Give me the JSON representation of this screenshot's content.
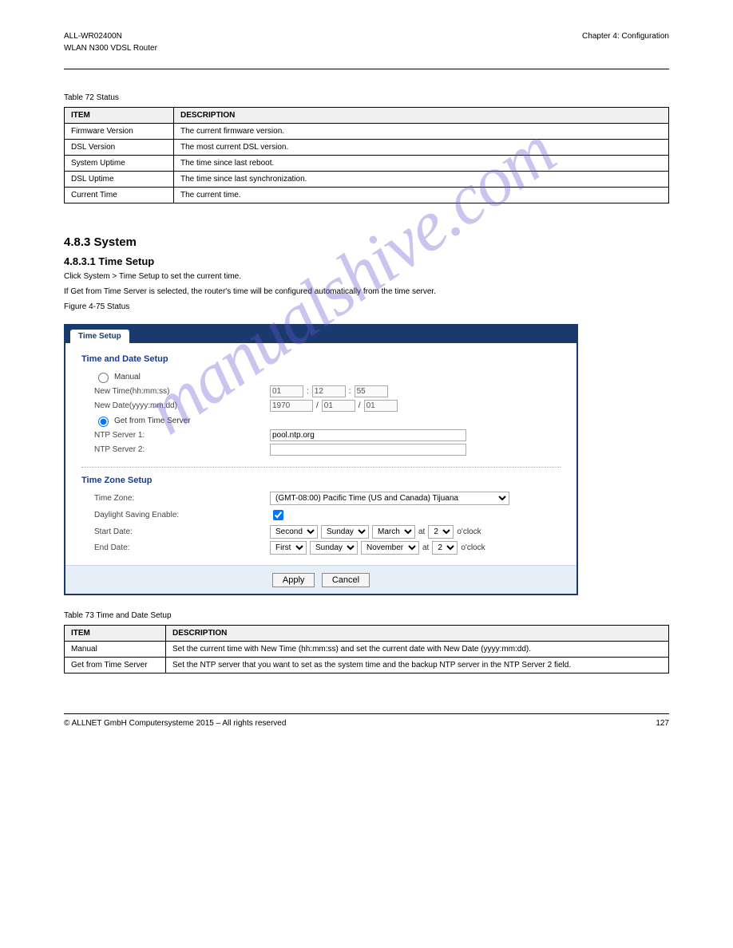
{
  "header": {
    "product_name": "ALL-WR02400N",
    "product_desc": "WLAN N300 VDSL Router",
    "right": "Chapter 4: Configuration"
  },
  "table1": {
    "title": "Table 72 Status",
    "headers": [
      "ITEM",
      "DESCRIPTION"
    ],
    "rows": [
      [
        "Firmware Version",
        "The current firmware version."
      ],
      [
        "DSL Version",
        "The most current DSL version."
      ],
      [
        "System Uptime",
        "The time since last reboot."
      ],
      [
        "DSL Uptime",
        "The time since last synchronization."
      ],
      [
        "Current Time",
        "The current time."
      ]
    ]
  },
  "section": {
    "heading": "4.8.3 System",
    "sub": "4.8.3.1 Time Setup",
    "para1": "Click System > Time Setup to set the current time.",
    "para2": "If Get from Time Server is selected, the router's time will be configured automatically from the time server.",
    "para3": "Figure 4-75 Status"
  },
  "screenshot": {
    "tab": "Time Setup",
    "sec1_title": "Time and Date Setup",
    "opt_manual": "Manual",
    "new_time_label": "New Time(hh:mm:ss)",
    "new_time": {
      "hh": "01",
      "colon": ":",
      "mm": "12",
      "ss": "55"
    },
    "new_date_label": "New Date(yyyy:mm:dd)",
    "new_date": {
      "yyyy": "1970",
      "sep": "/",
      "mm": "01",
      "dd": "01"
    },
    "opt_server": "Get from Time Server",
    "ntp1_label": "NTP Server 1:",
    "ntp1_value": "pool.ntp.org",
    "ntp2_label": "NTP Server 2:",
    "ntp2_value": "",
    "sec2_title": "Time Zone Setup",
    "tz_label": "Time Zone:",
    "tz_value": "(GMT-08:00) Pacific Time (US and Canada) Tijuana",
    "dst_label": "Daylight Saving Enable:",
    "start_label": "Start Date:",
    "start": {
      "ord": "Second",
      "day": "Sunday",
      "month": "March",
      "at": "at",
      "hour": "2",
      "oclock": "o'clock"
    },
    "end_label": "End Date:",
    "end": {
      "ord": "First",
      "day": "Sunday",
      "month": "November",
      "at": "at",
      "hour": "2",
      "oclock": "o'clock"
    },
    "apply": "Apply",
    "cancel": "Cancel"
  },
  "table2": {
    "title": "Table 73 Time and Date Setup",
    "headers": [
      "ITEM",
      "DESCRIPTION"
    ],
    "rows": [
      [
        "Manual",
        "Set the current time with New Time (hh:mm:ss) and set the current date with New Date (yyyy:mm:dd)."
      ],
      [
        "Get from Time Server",
        "Set the NTP server that you want to set as the system time and the backup NTP server in the NTP Server 2 field."
      ]
    ]
  },
  "footer": {
    "left": "© ALLNET GmbH Computersysteme 2015 – All rights reserved",
    "right": "127"
  },
  "watermark": "manualshive.com"
}
